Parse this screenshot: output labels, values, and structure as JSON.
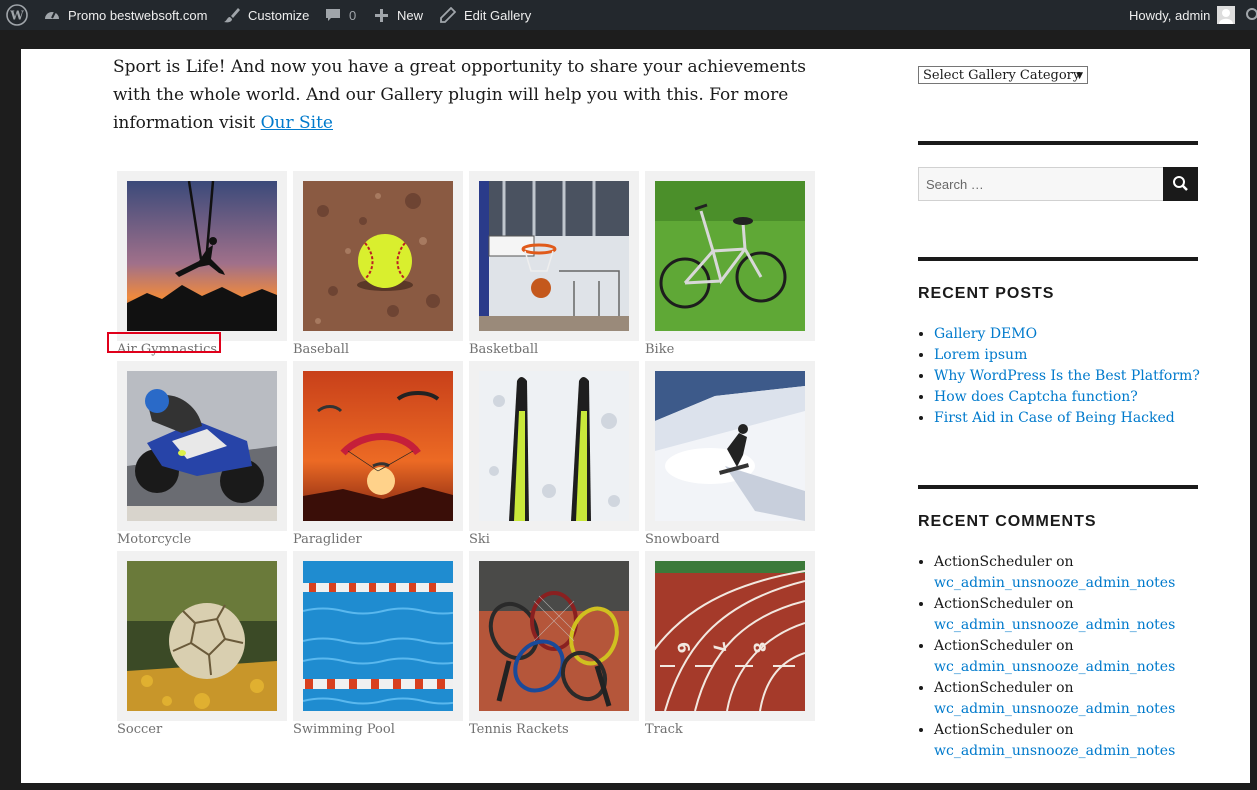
{
  "adminbar": {
    "site_name": "Promo bestwebsoft.com",
    "customize": "Customize",
    "comments_count": "0",
    "new_label": "New",
    "edit_gallery": "Edit Gallery",
    "howdy": "Howdy, admin"
  },
  "intro": {
    "text": "Sport is Life! And now you have a great opportunity to share your achievements with the whole world. And our Gallery plugin will help you with this. For more information visit ",
    "link_text": "Our Site"
  },
  "gallery": {
    "items": [
      {
        "caption": "Air Gymnastics"
      },
      {
        "caption": "Baseball"
      },
      {
        "caption": "Basketball"
      },
      {
        "caption": "Bike"
      },
      {
        "caption": "Motorcycle"
      },
      {
        "caption": "Paraglider"
      },
      {
        "caption": "Ski"
      },
      {
        "caption": "Snowboard"
      },
      {
        "caption": "Soccer"
      },
      {
        "caption": "Swimming Pool"
      },
      {
        "caption": "Tennis Rackets"
      },
      {
        "caption": "Track"
      }
    ]
  },
  "sidebar": {
    "category_select": "Select Gallery Category",
    "search_placeholder": "Search …",
    "recent_posts_title": "RECENT POSTS",
    "recent_posts": [
      "Gallery DEMO",
      "Lorem ipsum",
      "Why WordPress Is the Best Platform?",
      "How does Captcha function?",
      "First Aid in Case of Being Hacked"
    ],
    "recent_comments_title": "RECENT COMMENTS",
    "recent_comments": [
      {
        "author": "ActionScheduler",
        "on": "on",
        "post": "wc_admin_unsnooze_admin_notes"
      },
      {
        "author": "ActionScheduler",
        "on": "on",
        "post": "wc_admin_unsnooze_admin_notes"
      },
      {
        "author": "ActionScheduler",
        "on": "on",
        "post": "wc_admin_unsnooze_admin_notes"
      },
      {
        "author": "ActionScheduler",
        "on": "on",
        "post": "wc_admin_unsnooze_admin_notes"
      },
      {
        "author": "ActionScheduler",
        "on": "on",
        "post": "wc_admin_unsnooze_admin_notes"
      }
    ]
  },
  "colors": {
    "link": "#007acc",
    "adminbar": "#23282d",
    "highlight": "#e0001b"
  }
}
